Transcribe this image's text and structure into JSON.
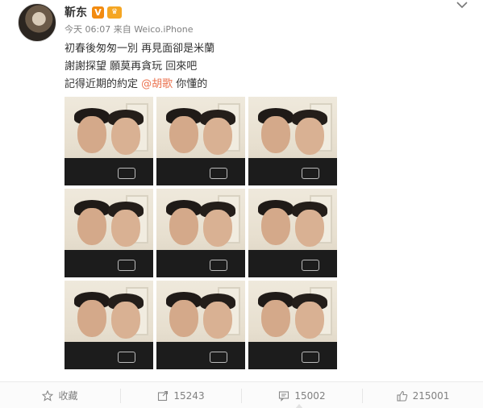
{
  "author": {
    "name": "靳东",
    "verified_badge": "V",
    "member_badge": "♛"
  },
  "meta": {
    "time": "今天 06:07",
    "source_prefix": "来自",
    "source": "Weico.iPhone"
  },
  "post": {
    "line1": "初春後匆匆一別 再見面卻是米蘭",
    "line2": "謝謝探望 願莫再貪玩 回來吧",
    "line3_before": "記得近期的約定 ",
    "mention": "@胡歌",
    "line3_after": " 你懂的"
  },
  "photos": {
    "count": 9
  },
  "actions": {
    "favorite_label": "收藏",
    "repost_count": "15243",
    "comment_count": "15002",
    "like_count": "215001"
  },
  "colors": {
    "mention": "#eb7350",
    "verified": "#f28b10",
    "meta_text": "#808080"
  }
}
